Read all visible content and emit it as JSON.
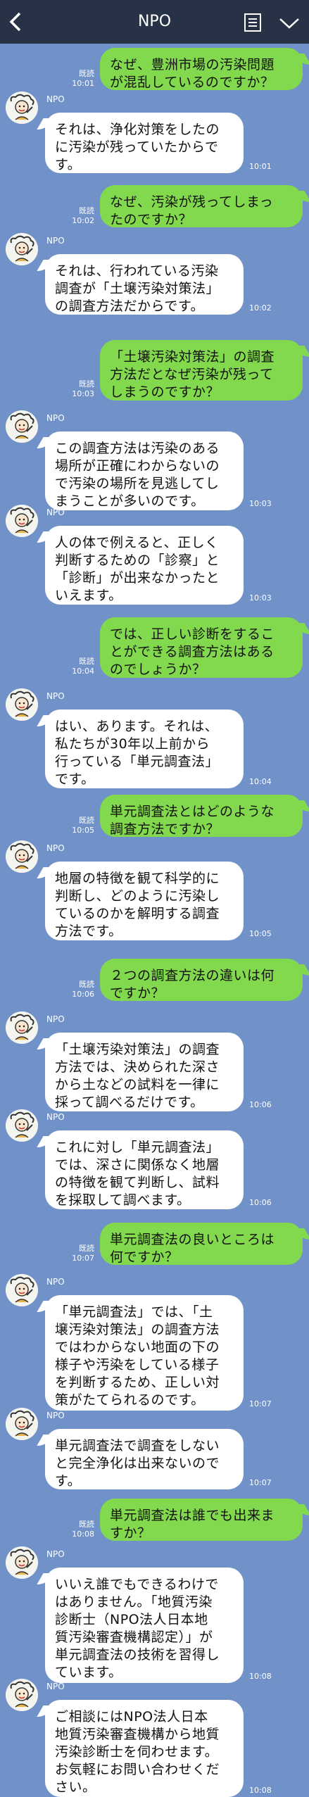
{
  "header": {
    "title": "NPO"
  },
  "messages": [
    {
      "side": "out",
      "text": "なぜ、豊洲市場の汚染問題\nが混乱しているのですか？",
      "read": "既読",
      "time": "10:01"
    },
    {
      "side": "in",
      "sender": "NPO",
      "text": "それは、浄化対策をしたの\nに汚染が残っていたからで\nす。",
      "time": "10:01"
    },
    {
      "side": "out",
      "text": "なぜ、汚染が残ってしまっ\nたのですか？",
      "read": "既読",
      "time": "10:02"
    },
    {
      "side": "in",
      "sender": "NPO",
      "text": "それは、行われている汚染\n調査が「土壌汚染対策法」\nの調査方法だからです。",
      "time": "10:02"
    },
    {
      "side": "out",
      "text": "「土壌汚染対策法」の調査\n方法だとなぜ汚染が残って\nしまうのですか？",
      "read": "既読",
      "time": "10:03"
    },
    {
      "side": "in",
      "sender": "NPO",
      "text": "この調査方法は汚染のある\n場所が正確にわからないの\nで汚染の場所を見逃してし\nまうことが多いのです。",
      "time": "10:03"
    },
    {
      "side": "in",
      "sender": "NPO",
      "text": "人の体で例えると、正しく\n判断するための「診察」と\n「診断」が出来なかったと\nいえます。",
      "time": "10:03"
    },
    {
      "side": "out",
      "text": "では、正しい診断をするこ\nとができる調査方法はある\nのでしょうか？",
      "read": "既読",
      "time": "10:04"
    },
    {
      "side": "in",
      "sender": "NPO",
      "text": "はい、あります。それは、\n私たちが30年以上前から\n行っている「単元調査法」\nです。",
      "time": "10:04"
    },
    {
      "side": "out",
      "text": "単元調査法とはどのような\n調査方法ですか？",
      "read": "既読",
      "time": "10:05"
    },
    {
      "side": "in",
      "sender": "NPO",
      "text": "地層の特徴を観て科学的に\n判断し、どのように汚染し\nているのかを解明する調査\n方法です。",
      "time": "10:05"
    },
    {
      "side": "out",
      "text": "２つの調査方法の違いは何\nですか？",
      "read": "既読",
      "time": "10:06"
    },
    {
      "side": "in",
      "sender": "NPO",
      "text": "「土壌汚染対策法」の調査\n方法では、決められた深さ\nから土などの試料を一律に\n採って調べるだけです。",
      "time": "10:06"
    },
    {
      "side": "in",
      "sender": "NPO",
      "text": "これに対し「単元調査法」\nでは、深さに関係なく地層\nの特徴を観て判断し、試料\nを採取して調べます。",
      "time": "10:06"
    },
    {
      "side": "out",
      "text": "単元調査法の良いところは\n何ですか？",
      "read": "既読",
      "time": "10:07"
    },
    {
      "side": "in",
      "sender": "NPO",
      "text": "「単元調査法」では、「土\n壌汚染対策法」の調査方法\nではわからない地面の下の\n様子や汚染をしている様子\nを判断するため、正しい対\n策がたてられるのです。",
      "time": "10:07"
    },
    {
      "side": "in",
      "sender": "NPO",
      "text": "単元調査法で調査をしない\nと完全浄化は出来ないので\nす。",
      "time": "10:07"
    },
    {
      "side": "out",
      "text": "単元調査法は誰でも出来ま\nすか？",
      "read": "既読",
      "time": "10:08"
    },
    {
      "side": "in",
      "sender": "NPO",
      "text": "いいえ誰でもできるわけで\nはありません。「地質汚染\n診断士（NPO法人日本地\n質汚染審査機構認定）」が\n単元調査法の技術を習得し\nています。",
      "time": "10:08"
    },
    {
      "side": "in",
      "sender": "NPO",
      "text": "ご相談にはNPO法人日本\n地質汚染審査機構から地質\n汚染診断士を伺わせます。\nお気軽にお問い合わせくだ\nさい。",
      "time": "10:08"
    }
  ]
}
